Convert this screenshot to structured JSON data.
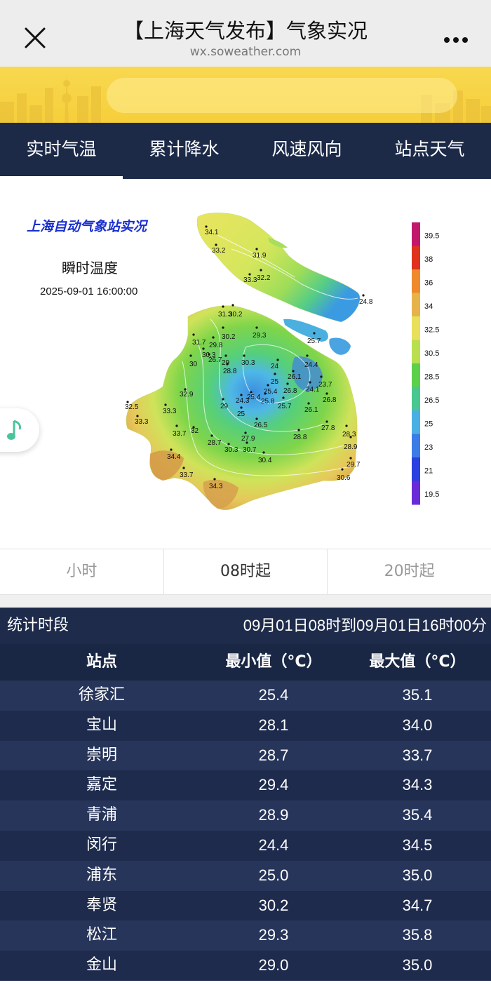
{
  "topbar": {
    "title": "【上海天气发布】气象实况",
    "url": "wx.soweather.com"
  },
  "tabs": [
    "实时气温",
    "累计降水",
    "风速风向",
    "站点天气"
  ],
  "map": {
    "heading": "上海自动气象站实况",
    "product": "瞬时温度",
    "timestamp": "2025-09-01 16:00:00",
    "legend": [
      {
        "value": "39.5",
        "color": "#c2186b"
      },
      {
        "value": "38",
        "color": "#e0301e"
      },
      {
        "value": "36",
        "color": "#ef8a2c"
      },
      {
        "value": "34",
        "color": "#e6b34a"
      },
      {
        "value": "32.5",
        "color": "#e8e05a"
      },
      {
        "value": "30.5",
        "color": "#b9df4f"
      },
      {
        "value": "28.5",
        "color": "#5dd04a"
      },
      {
        "value": "26.5",
        "color": "#48c890"
      },
      {
        "value": "25",
        "color": "#4ab0e4"
      },
      {
        "value": "23",
        "color": "#3c7ce6"
      },
      {
        "value": "21",
        "color": "#2c3fe0"
      },
      {
        "value": "19.5",
        "color": "#6a2ad8"
      }
    ],
    "stations": [
      {
        "label": "34.1"
      },
      {
        "label": "33.2"
      },
      {
        "label": "31.9"
      },
      {
        "label": "33.3"
      },
      {
        "label": "32.2"
      },
      {
        "label": "24.8"
      },
      {
        "label": "31.3"
      },
      {
        "label": "30.2"
      },
      {
        "label": "29.3"
      },
      {
        "label": "30.2"
      },
      {
        "label": "31.7"
      },
      {
        "label": "29.8"
      },
      {
        "label": "25.7"
      },
      {
        "label": "30.3"
      },
      {
        "label": "30"
      },
      {
        "label": "26.7"
      },
      {
        "label": "29"
      },
      {
        "label": "30.3"
      },
      {
        "label": "28.8"
      },
      {
        "label": "24"
      },
      {
        "label": "24.4"
      },
      {
        "label": "26.1"
      },
      {
        "label": "25"
      },
      {
        "label": "23.7"
      },
      {
        "label": "32.9"
      },
      {
        "label": "26.8"
      },
      {
        "label": "24.1"
      },
      {
        "label": "25.4"
      },
      {
        "label": "24.3"
      },
      {
        "label": "25.4"
      },
      {
        "label": "25.8"
      },
      {
        "label": "25.7"
      },
      {
        "label": "26.8"
      },
      {
        "label": "32.5"
      },
      {
        "label": "33.3"
      },
      {
        "label": "29"
      },
      {
        "label": "25"
      },
      {
        "label": "26.1"
      },
      {
        "label": "33.3"
      },
      {
        "label": "26.5"
      },
      {
        "label": "27.8"
      },
      {
        "label": "33.7"
      },
      {
        "label": "32"
      },
      {
        "label": "28.8"
      },
      {
        "label": "28.3"
      },
      {
        "label": "27.9"
      },
      {
        "label": "28.7"
      },
      {
        "label": "30.3"
      },
      {
        "label": "30.7"
      },
      {
        "label": "28.9"
      },
      {
        "label": "34.4"
      },
      {
        "label": "30.4"
      },
      {
        "label": "29.7"
      },
      {
        "label": "33.7"
      },
      {
        "label": "30.6"
      },
      {
        "label": "34.3"
      }
    ]
  },
  "segments": [
    "小时",
    "08时起",
    "20时起"
  ],
  "stats": {
    "period_label": "统计时段",
    "period_value": "09月01日08时到09月01日16时00分",
    "headers": [
      "站点",
      "最小值（°C）",
      "最大值（°C）"
    ],
    "rows": [
      {
        "station": "徐家汇",
        "min": "25.4",
        "max": "35.1"
      },
      {
        "station": "宝山",
        "min": "28.1",
        "max": "34.0"
      },
      {
        "station": "崇明",
        "min": "28.7",
        "max": "33.7"
      },
      {
        "station": "嘉定",
        "min": "29.4",
        "max": "34.3"
      },
      {
        "station": "青浦",
        "min": "28.9",
        "max": "35.4"
      },
      {
        "station": "闵行",
        "min": "24.4",
        "max": "34.5"
      },
      {
        "station": "浦东",
        "min": "25.0",
        "max": "35.0"
      },
      {
        "station": "奉贤",
        "min": "30.2",
        "max": "34.7"
      },
      {
        "station": "松江",
        "min": "29.3",
        "max": "35.8"
      },
      {
        "station": "金山",
        "min": "29.0",
        "max": "35.0"
      }
    ]
  }
}
